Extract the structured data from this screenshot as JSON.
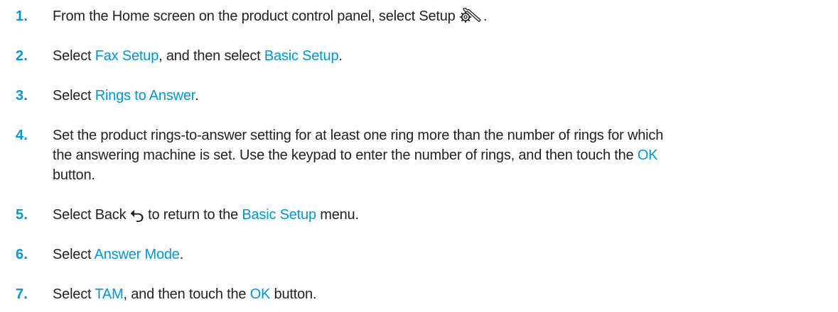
{
  "colors": {
    "accent": "#0096d6",
    "text": "#231f20"
  },
  "icons": {
    "setup": "wrench-gear-icon",
    "back": "back-arrow-icon"
  },
  "steps": [
    {
      "number": "1.",
      "t1": "From the Home screen on the product control panel, select Setup ",
      "t2": "."
    },
    {
      "number": "2.",
      "t1": "Select ",
      "link1": "Fax Setup",
      "t2": ", and then select ",
      "link2": "Basic Setup",
      "t3": "."
    },
    {
      "number": "3.",
      "t1": "Select ",
      "link1": "Rings to Answer",
      "t2": "."
    },
    {
      "number": "4.",
      "line1": "Set the product rings-to-answer setting for at least one ring more than the number of rings for which",
      "line2_text": "the answering machine is set. Use the keypad to enter the number of rings, and then touch the ",
      "line2_link": "OK",
      "line3": "button."
    },
    {
      "number": "5.",
      "t1": "Select Back ",
      "t2": " to return to the ",
      "link1": "Basic Setup",
      "t3": " menu."
    },
    {
      "number": "6.",
      "t1": "Select ",
      "link1": "Answer Mode",
      "t2": "."
    },
    {
      "number": "7.",
      "t1": "Select ",
      "link1": "TAM",
      "t2": ", and then touch the ",
      "link2": "OK",
      "t3": " button."
    }
  ]
}
